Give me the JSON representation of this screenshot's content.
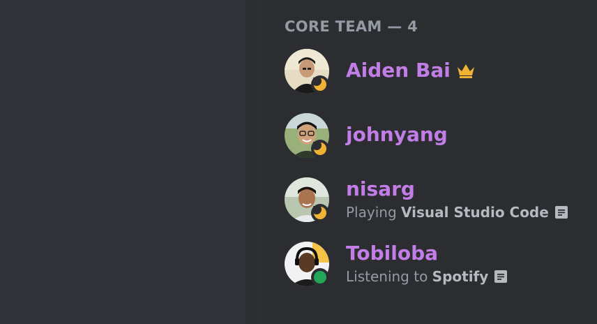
{
  "section": {
    "title": "CORE TEAM — 4"
  },
  "members": [
    {
      "name": "Aiden Bai",
      "status": "idle",
      "badge": "crown-icon",
      "activity_prefix": "",
      "activity_name": ""
    },
    {
      "name": "johnyang",
      "status": "idle",
      "badge": "",
      "activity_prefix": "",
      "activity_name": ""
    },
    {
      "name": "nisarg",
      "status": "idle",
      "badge": "",
      "activity_prefix": "Playing",
      "activity_name": "Visual Studio Code"
    },
    {
      "name": "Tobiloba",
      "status": "online",
      "badge": "",
      "activity_prefix": "Listening to",
      "activity_name": "Spotify"
    }
  ],
  "colors": {
    "background": "#313338",
    "panel": "#2b2d31",
    "role_color": "#c27de7",
    "idle": "#f0b232",
    "online": "#23a55a",
    "muted_text": "#949ba4"
  }
}
